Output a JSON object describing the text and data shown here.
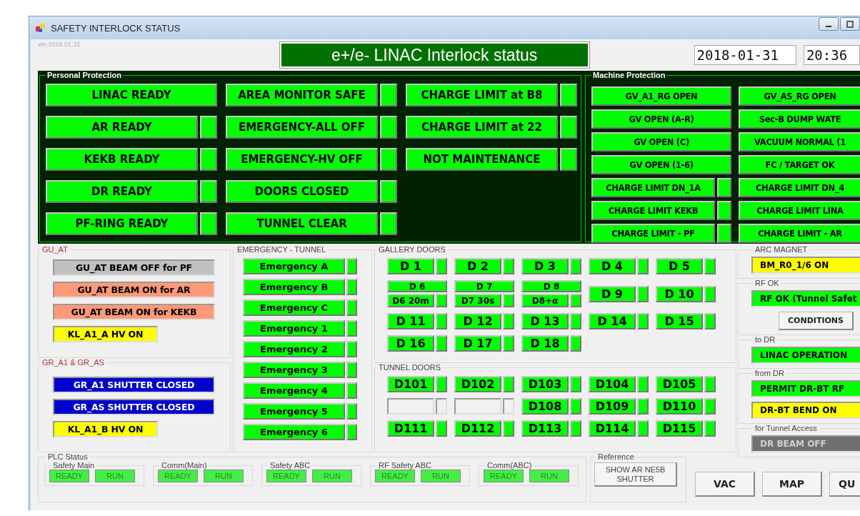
{
  "window": {
    "title": "SAFETY INTERLOCK STATUS"
  },
  "version": "ver.2018.01.31",
  "header": {
    "title": "e+/e- LINAC Interlock status",
    "date": "2018-01-31",
    "time": "20:36"
  },
  "personal_protection": {
    "title": "Personal Protection",
    "columns": [
      [
        {
          "label": "LINAC READY",
          "color": "#00ff00",
          "lamp": false
        },
        {
          "label": "AR READY",
          "color": "#00ff00",
          "lamp": true
        },
        {
          "label": "KEKB READY",
          "color": "#00ff00",
          "lamp": true
        },
        {
          "label": "DR READY",
          "color": "#00ff00",
          "lamp": true
        },
        {
          "label": "PF-RING READY",
          "color": "#00ff00",
          "lamp": true
        }
      ],
      [
        {
          "label": "AREA MONITOR SAFE",
          "color": "#00ff00",
          "lamp": true
        },
        {
          "label": "EMERGENCY-ALL OFF",
          "color": "#00ff00",
          "lamp": true
        },
        {
          "label": "EMERGENCY-HV OFF",
          "color": "#00ff00",
          "lamp": true
        },
        {
          "label": "DOORS CLOSED",
          "color": "#00ff00",
          "lamp": true
        },
        {
          "label": "TUNNEL CLEAR",
          "color": "#00ff00",
          "lamp": true
        }
      ],
      [
        {
          "label": "CHARGE LIMIT at B8",
          "color": "#00ff00",
          "lamp": true
        },
        {
          "label": "CHARGE LIMIT at 22",
          "color": "#00ff00",
          "lamp": true
        },
        {
          "label": "NOT MAINTENANCE",
          "color": "#00ff00",
          "lamp": true
        }
      ]
    ]
  },
  "machine_protection": {
    "title": "Machine Protection",
    "columns": [
      [
        {
          "label": "GV_A1_RG OPEN",
          "color": "#00ff00",
          "lamp": false
        },
        {
          "label": "GV OPEN (A-R)",
          "color": "#00ff00",
          "lamp": false
        },
        {
          "label": "GV OPEN (C)",
          "color": "#00ff00",
          "lamp": false
        },
        {
          "label": "GV OPEN (1-6)",
          "color": "#00ff00",
          "lamp": false
        },
        {
          "label": "CHARGE LIMIT DN_1A",
          "color": "#00ff00",
          "lamp": true
        },
        {
          "label": "CHARGE LIMIT  KEKB",
          "color": "#00ff00",
          "lamp": true
        },
        {
          "label": "CHARGE LIMIT - PF",
          "color": "#00ff00",
          "lamp": true
        }
      ],
      [
        {
          "label": "GV_AS_RG OPEN",
          "color": "#00ff00",
          "lamp": false
        },
        {
          "label": "Sec-B DUMP WATE",
          "color": "#00ff00",
          "lamp": false
        },
        {
          "label": "VACUUM NORMAL (1",
          "color": "#00ff00",
          "lamp": false
        },
        {
          "label": "FC / TARGET OK",
          "color": "#00ff00",
          "lamp": false
        },
        {
          "label": "CHARGE LIMIT DN_4",
          "color": "#00ff00",
          "lamp": false
        },
        {
          "label": "CHARGE LIMIT  LINA",
          "color": "#00ff00",
          "lamp": false
        },
        {
          "label": "CHARGE LIMIT - AR",
          "color": "#00ff00",
          "lamp": false
        }
      ]
    ]
  },
  "gu_at": {
    "title": "GU_AT",
    "items": [
      {
        "label": "GU_AT BEAM OFF for PF",
        "color": "#c0c0c0",
        "kind": "wide"
      },
      {
        "label": "GU_AT BEAM ON for AR",
        "color": "#ff9977",
        "kind": "wide"
      },
      {
        "label": "GU_AT BEAM ON for KEKB",
        "color": "#ff9977",
        "kind": "wide"
      },
      {
        "label": "KL_A1_A HV ON",
        "color": "#ffff00",
        "kind": "narrow"
      }
    ]
  },
  "gr": {
    "title": "GR_A1 & GR_AS",
    "items": [
      {
        "label": "GR_A1 SHUTTER CLOSED",
        "color": "#0000cc",
        "kind": "wide"
      },
      {
        "label": "GR_AS SHUTTER CLOSED",
        "color": "#0000cc",
        "kind": "wide"
      },
      {
        "label": "KL_A1_B HV ON",
        "color": "#ffff00",
        "kind": "narrow"
      }
    ]
  },
  "emergency_tunnel": {
    "title": "EMERGENCY - TUNNEL",
    "items": [
      {
        "label": "Emergency A",
        "color": "#00ff00",
        "lamp": true
      },
      {
        "label": "Emergency B",
        "color": "#00ff00",
        "lamp": true
      },
      {
        "label": "Emergency C",
        "color": "#00ff00",
        "lamp": true
      },
      {
        "label": "Emergency 1",
        "color": "#00ff00",
        "lamp": true
      },
      {
        "label": "Emergency 2",
        "color": "#00ff00",
        "lamp": true
      },
      {
        "label": "Emergency 3",
        "color": "#00ff00",
        "lamp": true
      },
      {
        "label": "Emergency 4",
        "color": "#00ff00",
        "lamp": true
      },
      {
        "label": "Emergency 5",
        "color": "#00ff00",
        "lamp": true
      },
      {
        "label": "Emergency 6",
        "color": "#00ff00",
        "lamp": true
      }
    ]
  },
  "gallery_doors": {
    "title": "GALLERY DOORS",
    "rows": [
      [
        {
          "kind": "door",
          "label": "D 1",
          "color": "#00ff00",
          "lamp": true
        },
        {
          "kind": "door",
          "label": "D 2",
          "color": "#00ff00",
          "lamp": true
        },
        {
          "kind": "door",
          "label": "D 3",
          "color": "#00ff00",
          "lamp": true
        },
        {
          "kind": "door",
          "label": "D 4",
          "color": "#00ff00",
          "lamp": true
        },
        {
          "kind": "door",
          "label": "D 5",
          "color": "#00ff00",
          "lamp": true
        }
      ],
      [
        {
          "kind": "split",
          "label": "D 6",
          "sub_label": "D6 20m",
          "color": "#00ff00",
          "lamp": true
        },
        {
          "kind": "split",
          "label": "D 7",
          "sub_label": "D7 30s",
          "color": "#00ff00",
          "lamp": true
        },
        {
          "kind": "split",
          "label": "D 8",
          "sub_label": "D8+α",
          "color": "#00ff00",
          "lamp": true
        },
        {
          "kind": "door",
          "label": "D 9",
          "color": "#00ff00",
          "lamp": true
        },
        {
          "kind": "door",
          "label": "D 10",
          "color": "#00ff00",
          "lamp": true
        }
      ],
      [
        {
          "kind": "door",
          "label": "D 11",
          "color": "#00ff00",
          "lamp": true
        },
        {
          "kind": "door",
          "label": "D 12",
          "color": "#00ff00",
          "lamp": true
        },
        {
          "kind": "door",
          "label": "D 13",
          "color": "#00ff00",
          "lamp": true
        },
        {
          "kind": "door",
          "label": "D 14",
          "color": "#00ff00",
          "lamp": true
        },
        {
          "kind": "door",
          "label": "D 15",
          "color": "#00ff00",
          "lamp": true
        }
      ],
      [
        {
          "kind": "door",
          "label": "D 16",
          "color": "#00ff00",
          "lamp": true
        },
        {
          "kind": "door",
          "label": "D 17",
          "color": "#00ff00",
          "lamp": true
        },
        {
          "kind": "door",
          "label": "D 18",
          "color": "#00ff00",
          "lamp": true
        }
      ]
    ]
  },
  "tunnel_doors": {
    "title": "TUNNEL DOORS",
    "rows": [
      [
        {
          "kind": "door",
          "label": "D101",
          "color": "#00ff00",
          "lamp": true
        },
        {
          "kind": "door",
          "label": "D102",
          "color": "#00ff00",
          "lamp": true
        },
        {
          "kind": "door",
          "label": "D103",
          "color": "#00ff00",
          "lamp": true
        },
        {
          "kind": "door",
          "label": "D104",
          "color": "#00ff00",
          "lamp": true
        },
        {
          "kind": "door",
          "label": "D105",
          "color": "#00ff00",
          "lamp": true
        }
      ],
      [
        {
          "kind": "blank"
        },
        {
          "kind": "blank"
        },
        {
          "kind": "door",
          "label": "D108",
          "color": "#00ff00",
          "lamp": true
        },
        {
          "kind": "door",
          "label": "D109",
          "color": "#00ff00",
          "lamp": true
        },
        {
          "kind": "door",
          "label": "D110",
          "color": "#00ff00",
          "lamp": true
        }
      ],
      [
        {
          "kind": "door",
          "label": "D111",
          "color": "#00ff00",
          "lamp": true
        },
        {
          "kind": "door",
          "label": "D112",
          "color": "#00ff00",
          "lamp": true
        },
        {
          "kind": "door",
          "label": "D113",
          "color": "#00ff00",
          "lamp": true
        },
        {
          "kind": "door",
          "label": "D114",
          "color": "#00ff00",
          "lamp": true
        },
        {
          "kind": "door",
          "label": "D115",
          "color": "#00ff00",
          "lamp": true
        }
      ]
    ]
  },
  "right_groups": [
    {
      "title": "ARC MAGNET",
      "items": [
        {
          "label": "BM_R0_1/6 ON",
          "color": "#ffff00"
        }
      ]
    },
    {
      "title": "RF OK",
      "items": [
        {
          "label": "RF OK (Tunnel Safet",
          "color": "#00ff00"
        }
      ],
      "button": "CONDITIONS"
    },
    {
      "title": "to DR",
      "items": [
        {
          "label": "LINAC OPERATION",
          "color": "#00ff00"
        }
      ]
    },
    {
      "title": "from DR",
      "items": [
        {
          "label": "PERMIT DR-BT RF",
          "color": "#00ff00"
        },
        {
          "label": "DR-BT BEND ON",
          "color": "#ffff00"
        }
      ]
    },
    {
      "title": "for Tunnel Access",
      "items": [
        {
          "label": "DR BEAM OFF",
          "color": "#707070"
        }
      ]
    }
  ],
  "plc_status": {
    "title": "PLC Status",
    "groups": [
      {
        "title": "Safety Main",
        "lamps": [
          {
            "label": "READY",
            "color": "#44ee44"
          },
          {
            "label": "RUN",
            "color": "#44ee44"
          }
        ]
      },
      {
        "title": "Comm(Main)",
        "lamps": [
          {
            "label": "READY",
            "color": "#44ee44"
          },
          {
            "label": "RUN",
            "color": "#44ee44"
          }
        ]
      },
      {
        "title": "Safety ABC",
        "lamps": [
          {
            "label": "READY",
            "color": "#44ee44"
          },
          {
            "label": "RUN",
            "color": "#44ee44"
          }
        ]
      },
      {
        "title": "RF Safety ABC",
        "lamps": [
          {
            "label": "READY",
            "color": "#44ee44"
          },
          {
            "label": "RUN",
            "color": "#44ee44"
          }
        ]
      },
      {
        "title": "Comm(ABC)",
        "lamps": [
          {
            "label": "READY",
            "color": "#44ee44"
          },
          {
            "label": "RUN",
            "color": "#44ee44"
          }
        ]
      }
    ]
  },
  "reference": {
    "title": "Reference",
    "button": "SHOW AR NE5B SHUTTER"
  },
  "buttons": [
    "VAC",
    "MAP",
    "QU"
  ]
}
